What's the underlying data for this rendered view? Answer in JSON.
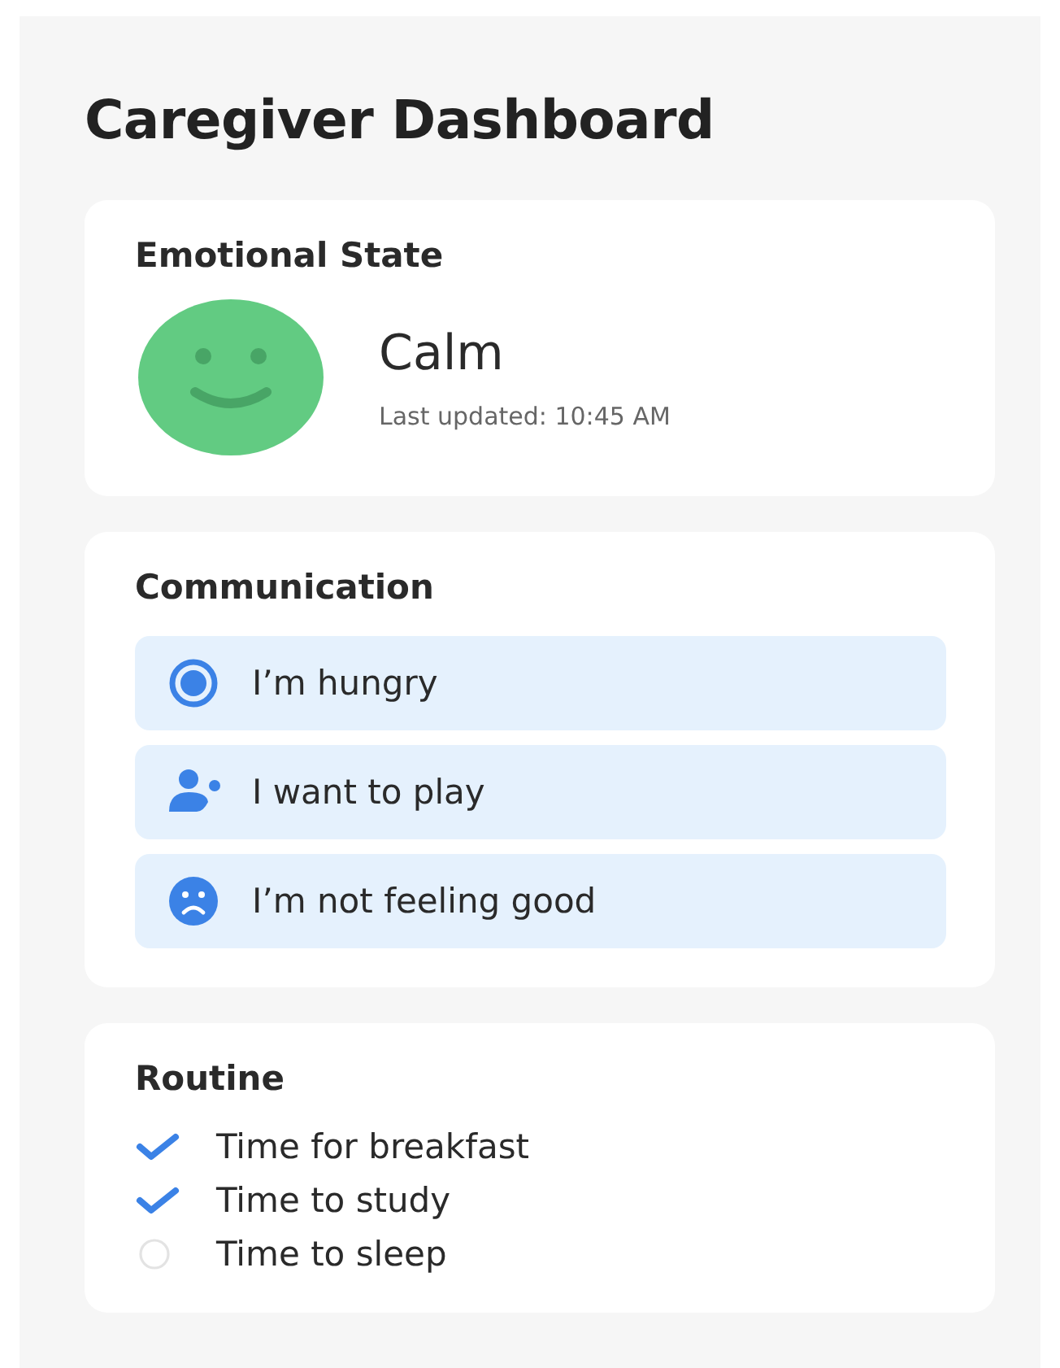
{
  "title": "Caregiver Dashboard",
  "emotional_state": {
    "heading": "Emotional State",
    "mood": "Calm",
    "updated": "Last updated: 10:45 AM"
  },
  "communication": {
    "heading": "Communication",
    "items": [
      {
        "kind": "target",
        "label": "I’m hungry"
      },
      {
        "kind": "person",
        "label": "I want to play"
      },
      {
        "kind": "sad",
        "label": "I’m not feeling good"
      }
    ]
  },
  "routine": {
    "heading": "Routine",
    "items": [
      {
        "label": "Time for breakfast",
        "checked": true
      },
      {
        "label": "Time to study",
        "checked": true
      },
      {
        "label": "Time to sleep",
        "checked": false
      }
    ]
  }
}
